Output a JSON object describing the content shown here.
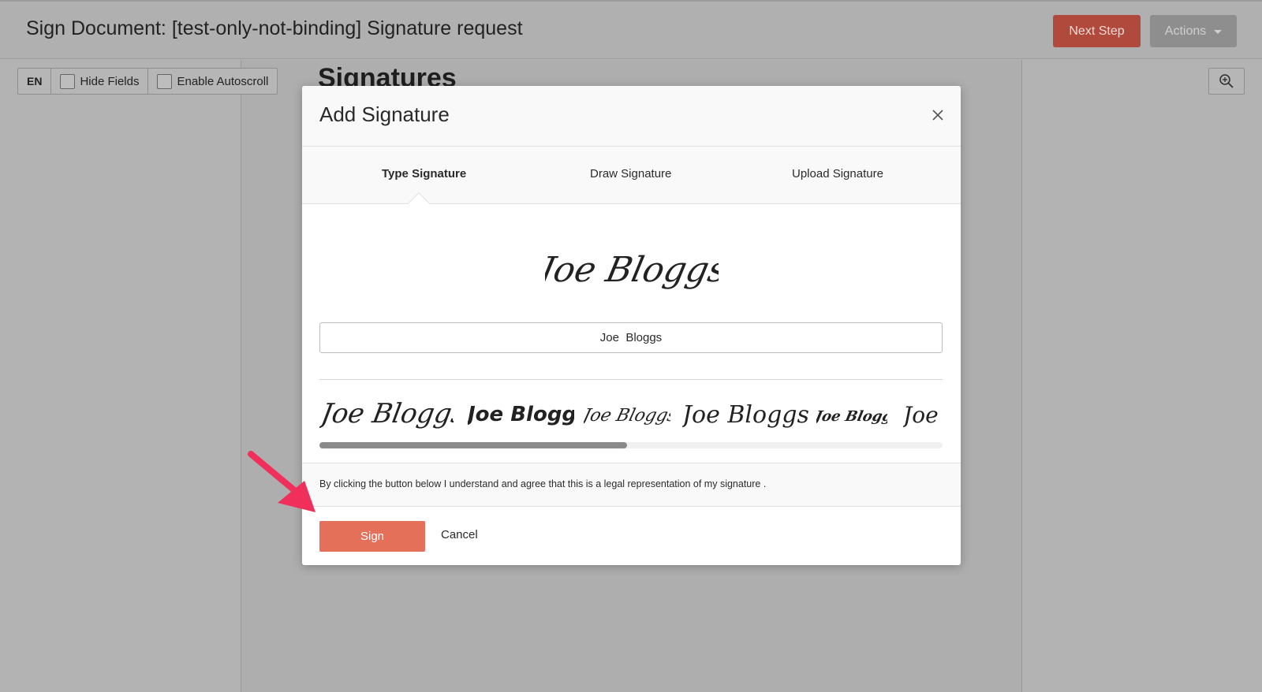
{
  "header": {
    "title": "Sign Document: [test-only-not-binding] Signature request",
    "next_step_label": "Next Step",
    "actions_label": "Actions"
  },
  "toolbar": {
    "language": "EN",
    "hide_fields_label": "Hide Fields",
    "autoscroll_label": "Enable Autoscroll"
  },
  "document": {
    "heading": "Signatures"
  },
  "modal": {
    "title": "Add Signature",
    "tabs": [
      {
        "label": "Type Signature",
        "active": true
      },
      {
        "label": "Draw Signature",
        "active": false
      },
      {
        "label": "Upload Signature",
        "active": false
      }
    ],
    "preview_text": "Joe Bloggs",
    "name_value": "Joe  Bloggs",
    "style_options": [
      "Joe Bloggs",
      "Joe Bloggs",
      "Joe Bloggs",
      "Joe Bloggs",
      "Joe Bloggs",
      "Joe"
    ],
    "legal_text": "By clicking the button below I understand and agree that this is a legal representation of my signature .",
    "sign_label": "Sign",
    "cancel_label": "Cancel"
  },
  "colors": {
    "next_step": "#b04a3c",
    "sign_button": "#e4705a",
    "annotation_arrow": "#f0305a"
  }
}
